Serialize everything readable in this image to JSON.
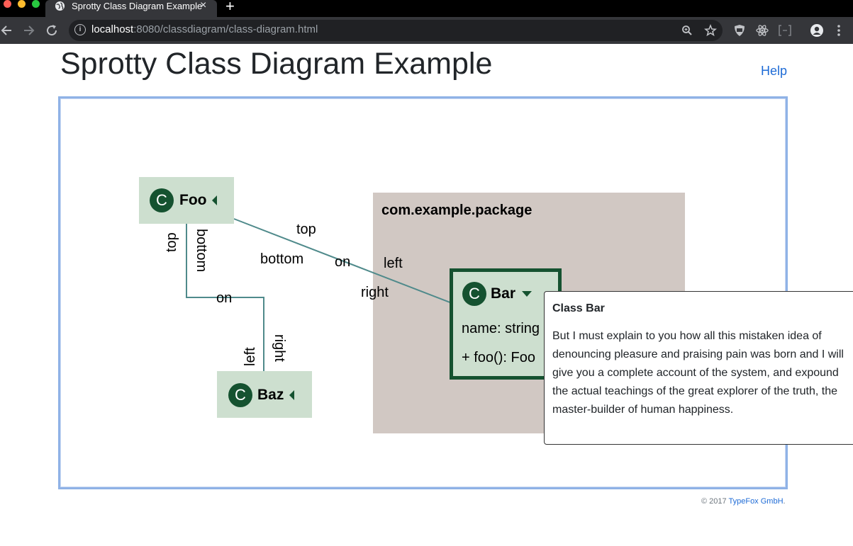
{
  "browser": {
    "tab_title": "Sprotty Class Diagram Example",
    "close_glyph": "×",
    "newtab_glyph": "+",
    "url_host": "localhost",
    "url_rest": ":8080/classdiagram/class-diagram.html",
    "traffic_colors": [
      "#ff5f57",
      "#febc2e",
      "#28c840"
    ]
  },
  "page": {
    "title": "Sprotty Class Diagram Example",
    "help": "Help"
  },
  "diagram": {
    "package": {
      "label": "com.example.package"
    },
    "nodes": {
      "foo": {
        "badge": "C",
        "name": "Foo"
      },
      "baz": {
        "badge": "C",
        "name": "Baz"
      },
      "bar": {
        "badge": "C",
        "name": "Bar",
        "members": [
          "name: string",
          "+ foo(): Foo"
        ]
      }
    },
    "edge_labels": {
      "foo_bar_top": "top",
      "foo_bar_bottom": "bottom",
      "foo_bar_on": "on",
      "foo_bar_left": "left",
      "foo_bar_right": "right",
      "foo_baz_top": "top",
      "foo_baz_bottom": "bottom",
      "foo_baz_on": "on",
      "foo_baz_left": "left",
      "foo_baz_right": "right"
    },
    "colors": {
      "edge": "#4f8a8b",
      "node_fill": "#cddfcf",
      "badge": "#155230",
      "package": "#d1c8c3"
    }
  },
  "tooltip": {
    "title": "Class Bar",
    "body": "But I must explain to you how all this mistaken idea of denouncing pleasure and praising pain was born and I will give you a complete account of the system, and expound the actual teachings of the great explorer of the truth, the master-builder of human happiness."
  },
  "footer": {
    "prefix": "© 2017 ",
    "link": "TypeFox GmbH",
    "suffix": "."
  }
}
